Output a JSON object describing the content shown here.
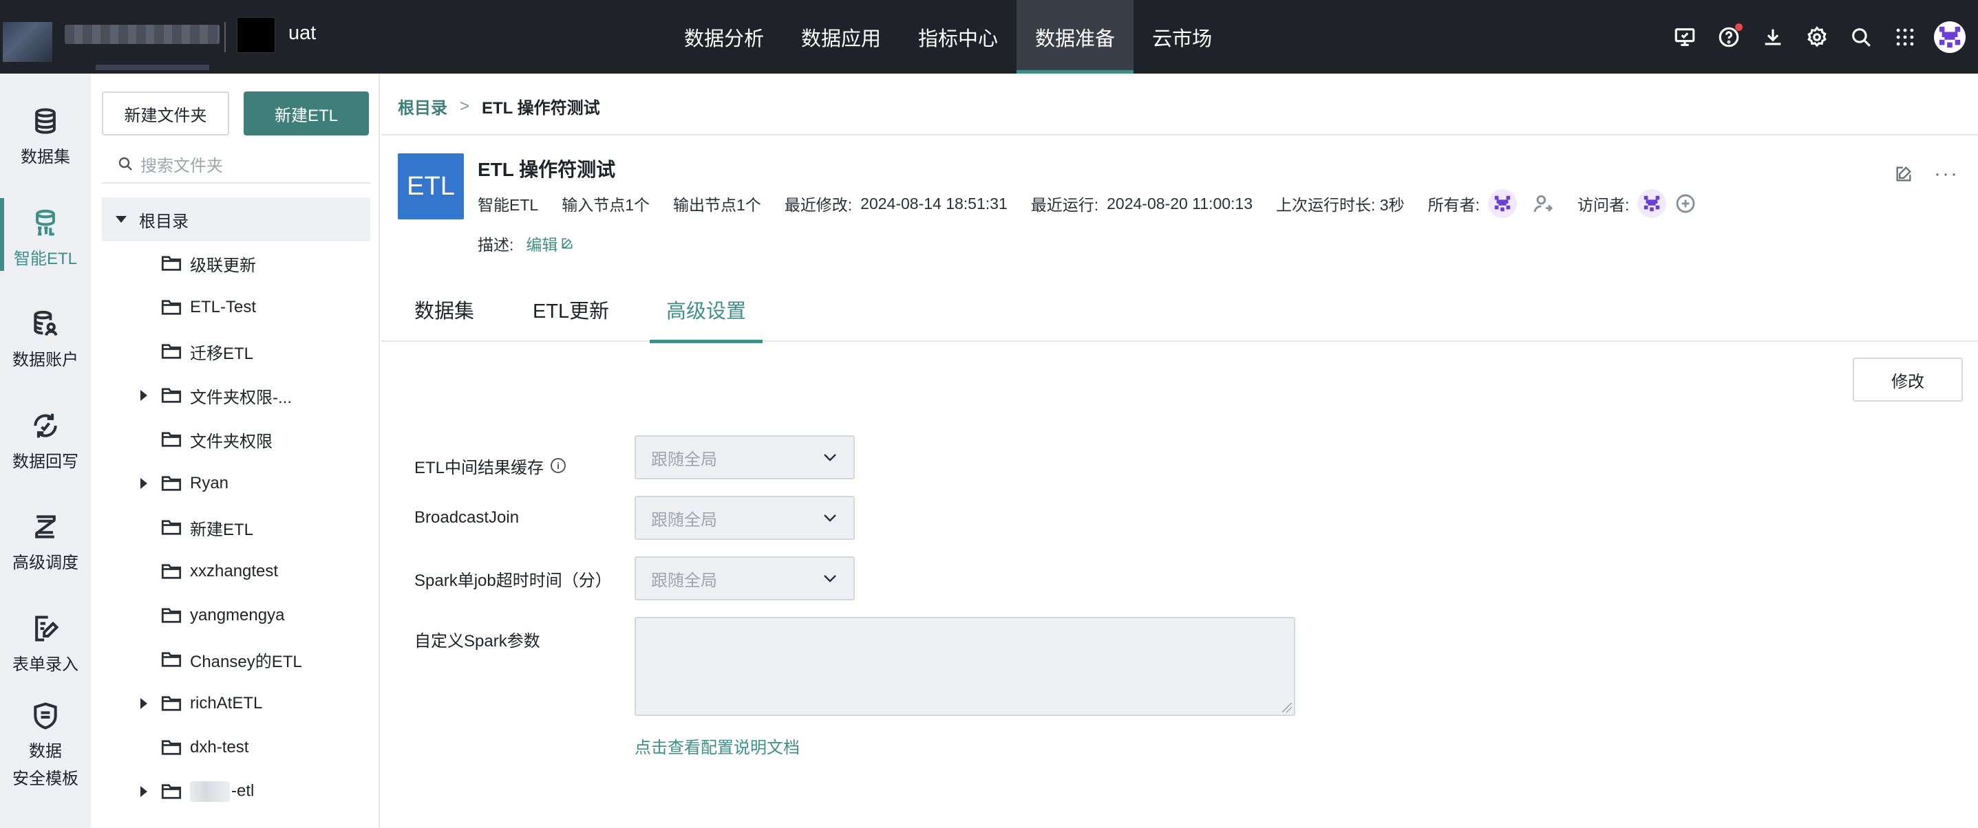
{
  "topbar": {
    "project_name": "uat",
    "nav": [
      {
        "label": "数据分析",
        "active": false
      },
      {
        "label": "数据应用",
        "active": false
      },
      {
        "label": "指标中心",
        "active": false
      },
      {
        "label": "数据准备",
        "active": true
      },
      {
        "label": "云市场",
        "active": false
      }
    ],
    "icons": [
      "monitor-icon",
      "help-icon",
      "download-icon",
      "settings-icon",
      "search-icon",
      "apps-grid-icon"
    ],
    "help_has_notification": true
  },
  "rail": {
    "items": [
      {
        "label": "数据集",
        "icon": "database-icon",
        "active": false
      },
      {
        "label": "智能ETL",
        "icon": "etl-icon",
        "active": true
      },
      {
        "label": "数据账户",
        "icon": "data-account-icon",
        "active": false
      },
      {
        "label": "数据回写",
        "icon": "writeback-icon",
        "active": false
      },
      {
        "label": "高级调度",
        "icon": "schedule-icon",
        "active": false
      },
      {
        "label": "表单录入",
        "icon": "form-entry-icon",
        "active": false
      },
      {
        "label_line1": "数据",
        "label_line2": "安全模板",
        "icon": "security-template-icon",
        "active": false
      }
    ]
  },
  "tree": {
    "new_folder_label": "新建文件夹",
    "new_etl_label": "新建ETL",
    "search_placeholder": "搜索文件夹",
    "root_label": "根目录",
    "items": [
      {
        "name": "级联更新",
        "expandable": false
      },
      {
        "name": "ETL-Test",
        "expandable": false
      },
      {
        "name": "迁移ETL",
        "expandable": false
      },
      {
        "name": "文件夹权限-...",
        "expandable": true
      },
      {
        "name": "文件夹权限",
        "expandable": false
      },
      {
        "name": "Ryan",
        "expandable": true
      },
      {
        "name": "新建ETL",
        "expandable": false
      },
      {
        "name": "xxzhangtest",
        "expandable": false
      },
      {
        "name": "yangmengya",
        "expandable": false
      },
      {
        "name": "Chansey的ETL",
        "expandable": false
      },
      {
        "name": "richAtETL",
        "expandable": true
      },
      {
        "name": "dxh-test",
        "expandable": false
      },
      {
        "name": "-etl",
        "expandable": true,
        "name_prefix_blurred": true
      }
    ]
  },
  "breadcrumb": {
    "root": "根目录",
    "separator": ">",
    "current": "ETL 操作符测试"
  },
  "etl": {
    "logo_text": "ETL",
    "title": "ETL 操作符测试",
    "type": "智能ETL",
    "input_nodes": "输入节点1个",
    "output_nodes": "输出节点1个",
    "last_modified_label": "最近修改:",
    "last_modified": "2024-08-14 18:51:31",
    "last_run_label": "最近运行:",
    "last_run": "2024-08-20 11:00:13",
    "last_duration": "上次运行时长: 3秒",
    "owner_label": "所有者:",
    "visitor_label": "访问者:",
    "desc_label": "描述:",
    "edit_label": "编辑"
  },
  "tabs": [
    {
      "label": "数据集",
      "active": false
    },
    {
      "label": "ETL更新",
      "active": false
    },
    {
      "label": "高级设置",
      "active": true
    }
  ],
  "settings": {
    "modify_label": "修改",
    "fields": [
      {
        "label": "ETL中间结果缓存",
        "has_info": true,
        "placeholder": "跟随全局"
      },
      {
        "label": "BroadcastJoin",
        "has_info": false,
        "placeholder": "跟随全局"
      },
      {
        "label": "Spark单job超时时间（分）",
        "has_info": false,
        "placeholder": "跟随全局"
      }
    ],
    "custom_spark_label": "自定义Spark参数",
    "custom_spark_value": "",
    "doc_link": "点击查看配置说明文档"
  },
  "colors": {
    "topbar_bg": "#1f2329",
    "accent": "#3f8f88",
    "primary_button": "#3f7f7a",
    "etl_logo": "#3376cd"
  }
}
